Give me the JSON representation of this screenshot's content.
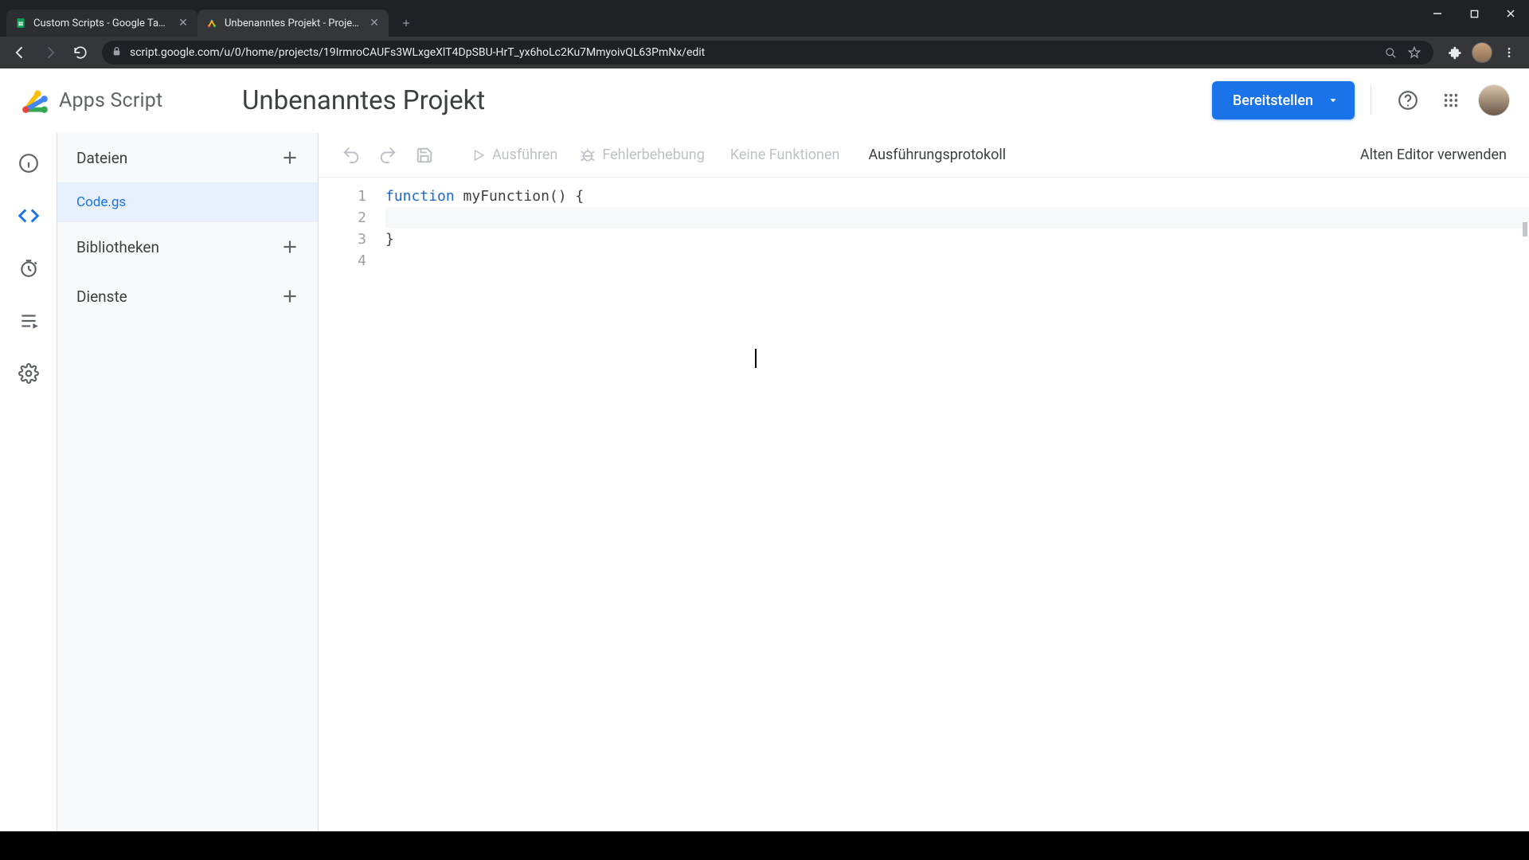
{
  "browser": {
    "tabs": [
      {
        "title": "Custom Scripts - Google Tabellen",
        "active": false
      },
      {
        "title": "Unbenanntes Projekt - Projekt-E",
        "active": true
      }
    ],
    "url": "script.google.com/u/0/home/projects/19IrmroCAUFs3WLxgeXlT4DpSBU-HrT_yx6hoLc2Ku7MmyoivQL63PmNx/edit"
  },
  "header": {
    "brand": "Apps Script",
    "project_title": "Unbenanntes Projekt",
    "deploy_label": "Bereitstellen"
  },
  "sidebar": {
    "files_label": "Dateien",
    "libraries_label": "Bibliotheken",
    "services_label": "Dienste",
    "active_file": "Code.gs"
  },
  "toolbar": {
    "run_label": "Ausführen",
    "debug_label": "Fehlerbehebung",
    "no_functions_label": "Keine Funktionen",
    "exec_log_label": "Ausführungsprotokoll",
    "old_editor_label": "Alten Editor verwenden"
  },
  "code": {
    "line_numbers": [
      "1",
      "2",
      "3",
      "4"
    ],
    "tokens": {
      "kw_function": "function",
      "fn_name": " myFunction() ",
      "open_brace": "{",
      "close_brace": "}"
    }
  }
}
